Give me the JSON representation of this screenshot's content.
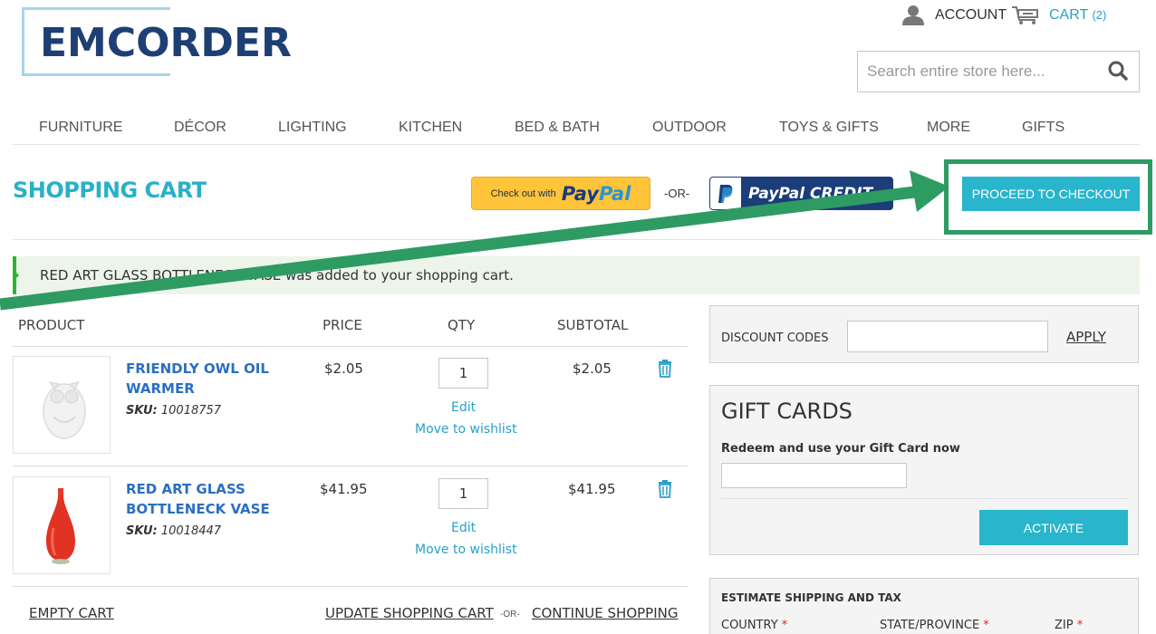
{
  "header": {
    "logo_text_a": "EMC",
    "logo_text_b": "ORDER",
    "account_label": "ACCOUNT",
    "cart_label": "CART",
    "cart_count": "(2)",
    "search_placeholder": "Search entire store here..."
  },
  "nav": {
    "items": [
      {
        "label": "FURNITURE"
      },
      {
        "label": "DÉCOR"
      },
      {
        "label": "LIGHTING"
      },
      {
        "label": "KITCHEN"
      },
      {
        "label": "BED & BATH"
      },
      {
        "label": "OUTDOOR"
      },
      {
        "label": "TOYS & GIFTS"
      },
      {
        "label": "MORE"
      },
      {
        "label": "GIFTS"
      }
    ]
  },
  "cart_header": {
    "title": "SHOPPING CART",
    "paypal_small": "Check out with",
    "paypal_pay": "Pay",
    "paypal_pal": "Pal",
    "or_text": "-OR-",
    "paypal_credit": "PayPal CREDIT",
    "checkout_button": "PROCEED TO CHECKOUT"
  },
  "message": {
    "text": "RED ART GLASS BOTTLENECK VASE was added to your shopping cart."
  },
  "table": {
    "headers": {
      "product": "PRODUCT",
      "price": "PRICE",
      "qty": "QTY",
      "subtotal": "SUBTOTAL"
    },
    "rows": [
      {
        "name": "FRIENDLY OWL OIL WARMER",
        "sku_label": "SKU:",
        "sku": "10018757",
        "price": "$2.05",
        "qty": "1",
        "subtotal": "$2.05",
        "edit": "Edit",
        "wishlist": "Move to wishlist"
      },
      {
        "name": "RED ART GLASS BOTTLENECK VASE",
        "sku_label": "SKU:",
        "sku": "10018447",
        "price": "$41.95",
        "qty": "1",
        "subtotal": "$41.95",
        "edit": "Edit",
        "wishlist": "Move to wishlist"
      }
    ]
  },
  "actions": {
    "empty_cart": "EMPTY CART",
    "update_cart": "UPDATE SHOPPING CART",
    "or_text": "-OR-",
    "continue_shopping": "CONTINUE SHOPPING"
  },
  "discount": {
    "label": "DISCOUNT CODES",
    "apply": "APPLY"
  },
  "gift_cards": {
    "title": "GIFT CARDS",
    "subtitle": "Redeem and use your Gift Card now",
    "activate": "ACTIVATE"
  },
  "shipping": {
    "title": "ESTIMATE SHIPPING AND TAX",
    "country": "COUNTRY",
    "state": "STATE/PROVINCE",
    "zip": "ZIP",
    "required_mark": "*"
  },
  "colors": {
    "accent": "#29b5cc",
    "title": "#2ab0c9",
    "link": "#2a6fc0",
    "annotation": "#2e9b63",
    "success_bar": "#2eb52e"
  }
}
